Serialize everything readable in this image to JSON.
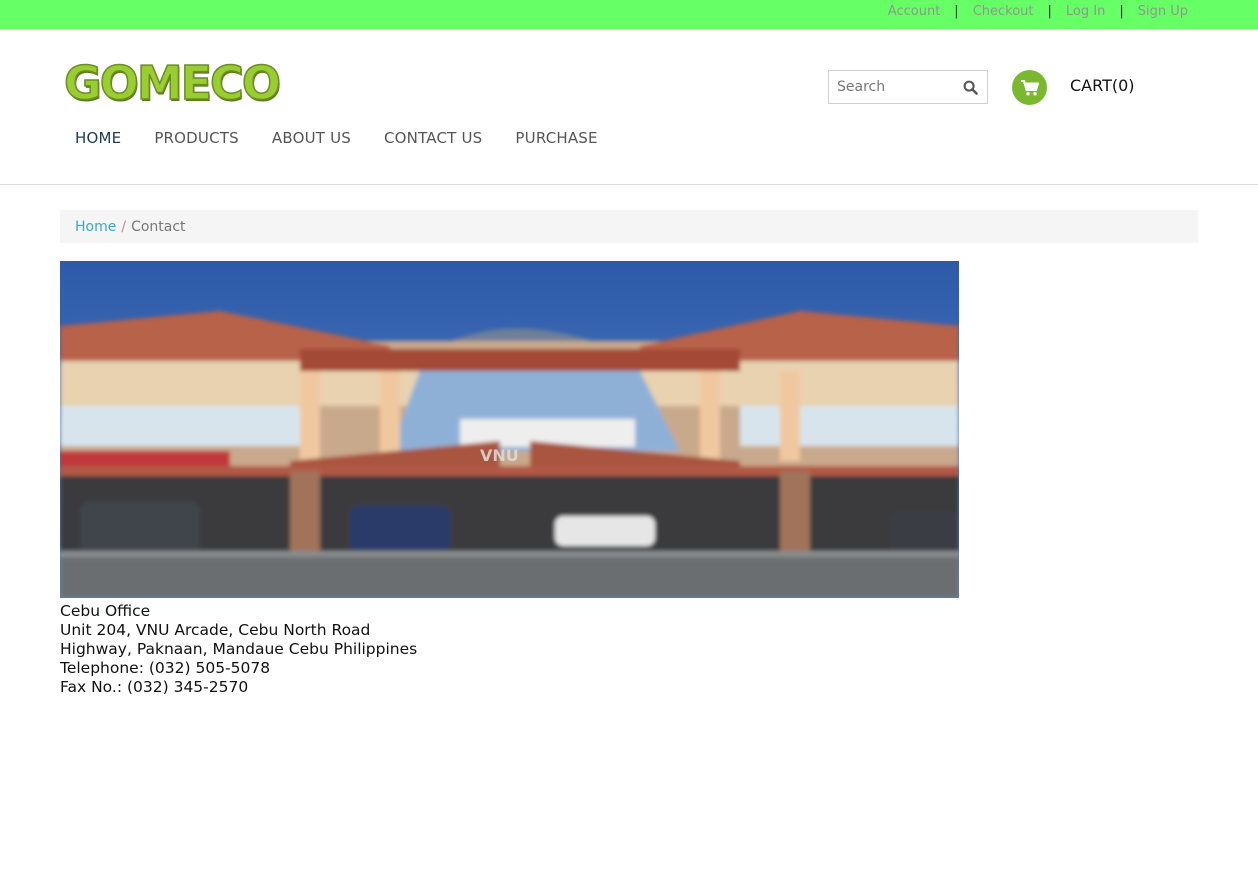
{
  "topbar": {
    "links": [
      "Account",
      "Checkout",
      "Log In",
      "Sign Up"
    ],
    "bg_color": "#66ff66"
  },
  "header": {
    "logo_text": "GOMECO",
    "search": {
      "placeholder": "Search",
      "icon": "search-icon"
    },
    "cart": {
      "label": "CART(0)",
      "icon": "shopping-cart-icon",
      "accent": "#7cb82f"
    }
  },
  "nav": {
    "items": [
      "HOME",
      "PRODUCTS",
      "ABOUT US",
      "CONTACT US",
      "PURCHASE"
    ],
    "active": "HOME"
  },
  "breadcrumb": {
    "home": "Home",
    "separator": "/",
    "current": "Contact"
  },
  "office": {
    "lines": [
      "Cebu Office",
      "Unit 204, VNU Arcade, Cebu North Road",
      "Highway, Paknaan, Mandaue Cebu Philippines",
      "Telephone: (032) 505-5078",
      "Fax No.: (032) 345-2570"
    ],
    "photo_text": {
      "banner": "VNU"
    }
  }
}
